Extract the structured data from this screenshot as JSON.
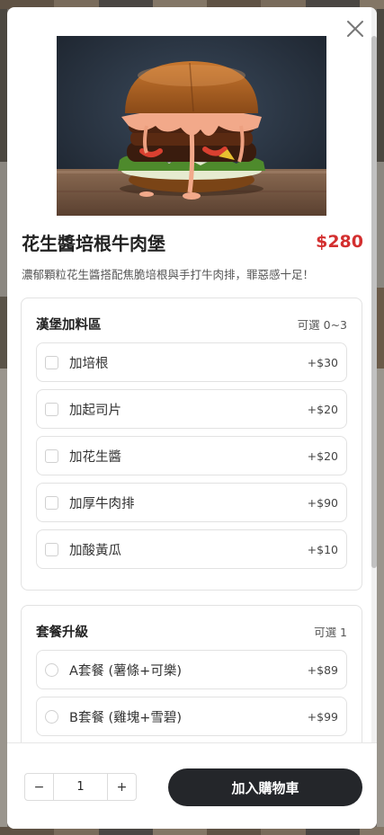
{
  "product": {
    "title": "花生醬培根牛肉堡",
    "price": "$280",
    "description": "濃郁顆粒花生醬搭配焦脆培根與手打牛肉排，罪惡感十足！"
  },
  "addons": {
    "title": "漢堡加料區",
    "note": "可選 0~3",
    "options": [
      {
        "label": "加培根",
        "price": "+$30"
      },
      {
        "label": "加起司片",
        "price": "+$20"
      },
      {
        "label": "加花生醬",
        "price": "+$20"
      },
      {
        "label": "加厚牛肉排",
        "price": "+$90"
      },
      {
        "label": "加酸黃瓜",
        "price": "+$10"
      }
    ]
  },
  "combo": {
    "title": "套餐升級",
    "note": "可選 1",
    "options": [
      {
        "label": "A套餐 (薯條+可樂)",
        "price": "+$89"
      },
      {
        "label": "B套餐 (雞塊+雪碧)",
        "price": "+$99"
      }
    ]
  },
  "footer": {
    "minus": "−",
    "quantity": "1",
    "plus": "+",
    "add_to_cart": "加入購物車"
  },
  "icons": {
    "close": "close-icon",
    "checkbox": "checkbox",
    "radio": "radio-button"
  },
  "colors": {
    "price": "#d32f2f",
    "button": "#24262a"
  }
}
